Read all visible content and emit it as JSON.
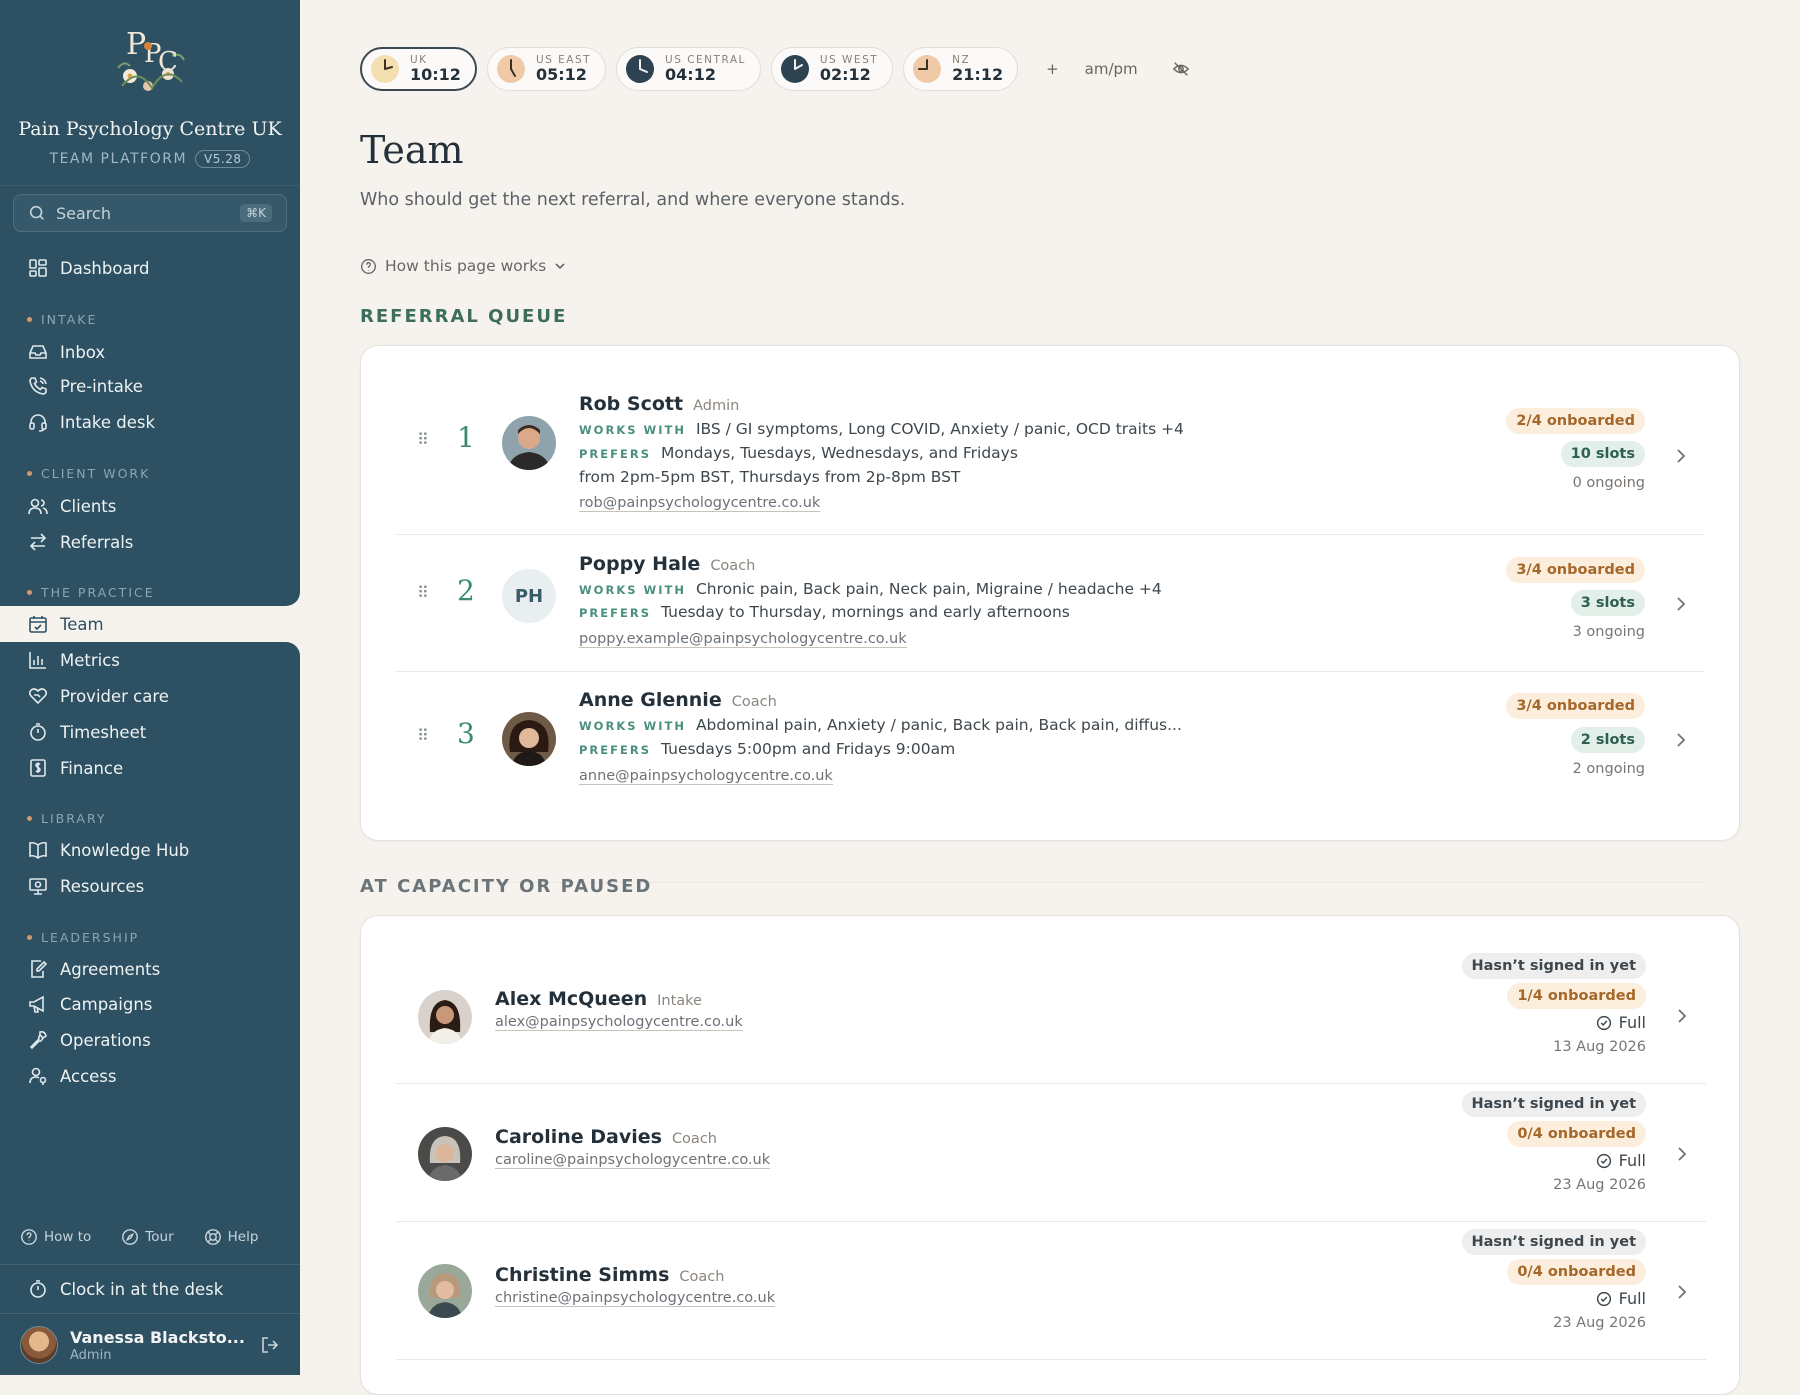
{
  "sidebar": {
    "brand_title": "Pain Psychology Centre UK",
    "brand_sub": "TEAM PLATFORM",
    "version": "V5.28",
    "search_placeholder": "Search",
    "search_kbd": "⌘K",
    "dashboard": "Dashboard",
    "sections": {
      "intake": "INTAKE",
      "client_work": "CLIENT WORK",
      "practice": "THE PRACTICE",
      "library": "LIBRARY",
      "leadership": "LEADERSHIP"
    },
    "items": {
      "inbox": "Inbox",
      "pre_intake": "Pre-intake",
      "intake_desk": "Intake desk",
      "clients": "Clients",
      "referrals": "Referrals",
      "team": "Team",
      "metrics": "Metrics",
      "provider_care": "Provider care",
      "timesheet": "Timesheet",
      "finance": "Finance",
      "knowledge_hub": "Knowledge Hub",
      "resources": "Resources",
      "agreements": "Agreements",
      "campaigns": "Campaigns",
      "operations": "Operations",
      "access": "Access"
    },
    "footer": {
      "how_to": "How to",
      "tour": "Tour",
      "help": "Help"
    },
    "clock_in": "Clock in at the desk",
    "user": {
      "name": "Vanessa Blacksto...",
      "role": "Admin"
    }
  },
  "clocks": [
    {
      "label": "UK",
      "time": "10:12",
      "face": "#f3dfb2",
      "hand": "#3b3022"
    },
    {
      "label": "US EAST",
      "time": "05:12",
      "face": "#f0c9a6",
      "hand": "#3b3022"
    },
    {
      "label": "US CENTRAL",
      "time": "04:12",
      "face": "#2d4352",
      "hand": "#f0f0f0"
    },
    {
      "label": "US WEST",
      "time": "02:12",
      "face": "#2d4352",
      "hand": "#f0f0f0"
    },
    {
      "label": "NZ",
      "time": "21:12",
      "face": "#f0c9a6",
      "hand": "#3b3022"
    }
  ],
  "clock_add": "+",
  "clock_ampm": "am/pm",
  "page": {
    "title": "Team",
    "subtitle": "Who should get the next referral, and where everyone stands.",
    "how_link": "How this page works"
  },
  "referral_queue": {
    "heading": "REFERRAL QUEUE",
    "works_tag": "WORKS WITH",
    "prefers_tag": "PREFERS",
    "members": [
      {
        "rank": "1",
        "name": "Rob Scott",
        "role": "Admin",
        "works": "IBS / GI symptoms, Long COVID, Anxiety / panic, OCD traits +4",
        "prefers": "Mondays, Tuesdays, Wednesdays, and Fridays",
        "prefers2": "from 2pm-5pm BST, Thursdays from 2p-8pm BST",
        "email": "rob@painpsychologycentre.co.uk",
        "onboarded": "2/4 onboarded",
        "slots": "10 slots",
        "ongoing": "0 ongoing"
      },
      {
        "rank": "2",
        "name": "Poppy Hale",
        "role": "Coach",
        "initials": "PH",
        "works": "Chronic pain, Back pain, Neck pain, Migraine / headache +4",
        "prefers": "Tuesday to Thursday, mornings and early afternoons",
        "email": "poppy.example@painpsychologycentre.co.uk",
        "onboarded": "3/4 onboarded",
        "slots": "3 slots",
        "ongoing": "3 ongoing"
      },
      {
        "rank": "3",
        "name": "Anne Glennie",
        "role": "Coach",
        "works": "Abdominal pain, Anxiety / panic, Back pain, Back pain, diffus...",
        "prefers": "Tuesdays 5:00pm and Fridays 9:00am",
        "email": "anne@painpsychologycentre.co.uk",
        "onboarded": "3/4 onboarded",
        "slots": "2 slots",
        "ongoing": "2 ongoing"
      }
    ]
  },
  "capacity": {
    "heading": "AT CAPACITY OR PAUSED",
    "members": [
      {
        "name": "Alex McQueen",
        "role": "Intake",
        "email": "alex@painpsychologycentre.co.uk",
        "signin": "Hasn’t signed in yet",
        "onboarded": "1/4 onboarded",
        "status": "Full",
        "date": "13 Aug 2026"
      },
      {
        "name": "Caroline Davies",
        "role": "Coach",
        "email": "caroline@painpsychologycentre.co.uk",
        "signin": "Hasn’t signed in yet",
        "onboarded": "0/4 onboarded",
        "status": "Full",
        "date": "23 Aug 2026"
      },
      {
        "name": "Christine Simms",
        "role": "Coach",
        "email": "christine@painpsychologycentre.co.uk",
        "signin": "Hasn’t signed in yet",
        "onboarded": "0/4 onboarded",
        "status": "Full",
        "date": "23 Aug 2026"
      }
    ]
  },
  "colors": {
    "sidebar": "#2d5062",
    "accent_green": "#3a8a78",
    "background": "#f6f3ef"
  }
}
